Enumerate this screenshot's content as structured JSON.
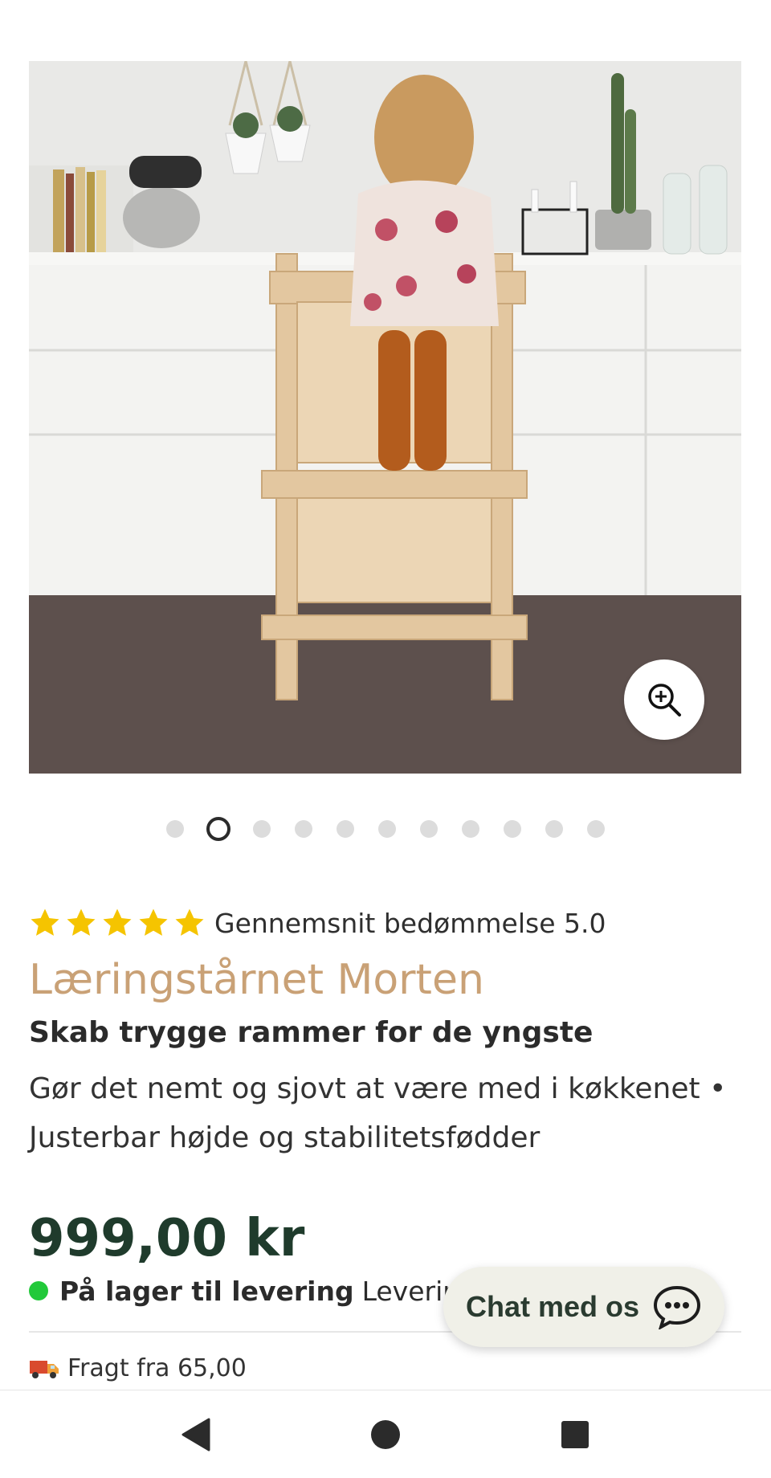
{
  "product": {
    "image_alt": "Læringstårnet Morten",
    "gallery": {
      "total_images": 11,
      "active_index": 1
    },
    "rating": {
      "stars": 5,
      "label": "Gennemsnit bedømmelse 5.0"
    },
    "title": "Læringstårnet Morten",
    "subtitle": "Skab trygge rammer for de yngste",
    "description": "Gør det nemt og sjovt at være med i køkkenet • Justerbar højde og stabilitetsfødder",
    "price": "999,00 kr",
    "stock_status_bold": "På lager til levering",
    "stock_status_rest": "Leveringst",
    "shipping": "Fragt fra 65,00"
  },
  "chat": {
    "label": "Chat med os"
  },
  "colors": {
    "title": "#c9a176",
    "price": "#1f3b2c",
    "stock_dot": "#22c93a",
    "star": "#f5c400",
    "chat_bg": "#f0f0e8"
  },
  "icons": {
    "zoom": "zoom-in-icon",
    "star": "star-icon",
    "truck": "truck-icon",
    "chat": "chat-bubble-icon",
    "nav_back": "back-triangle-icon",
    "nav_home": "home-circle-icon",
    "nav_recents": "recents-square-icon"
  }
}
